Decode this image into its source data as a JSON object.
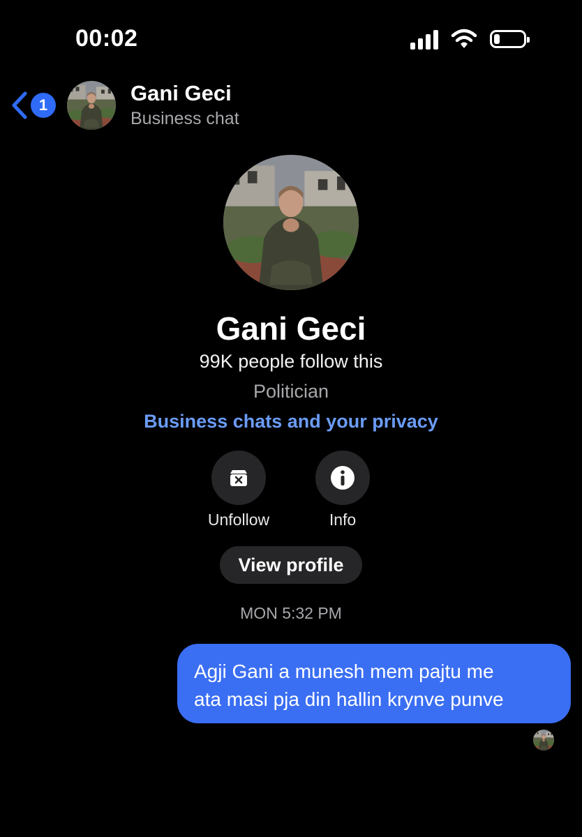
{
  "status_bar": {
    "time": "00:02",
    "signal_icon": "cellular-signal-icon",
    "wifi_icon": "wifi-icon",
    "battery_icon": "battery-icon",
    "battery_level": 0.2
  },
  "header": {
    "back_icon": "chevron-left-icon",
    "unread_count": "1",
    "name": "Gani Geci",
    "subtitle": "Business chat"
  },
  "profile": {
    "name": "Gani Geci",
    "followers": "99K people follow this",
    "category": "Politician",
    "privacy_link": "Business chats and your privacy"
  },
  "actions": [
    {
      "label": "Unfollow",
      "icon": "unfollow-icon"
    },
    {
      "label": "Info",
      "icon": "info-icon"
    }
  ],
  "view_profile_label": "View profile",
  "conversation": {
    "timestamp": "MON 5:32 PM",
    "messages": [
      {
        "sender": "me",
        "lines": [
          "Agji Gani a munesh mem pajtu me",
          "ata masi pja din hallin krynve punve"
        ]
      }
    ]
  },
  "colors": {
    "background": "#000000",
    "accent": "#2f6bf6",
    "bubble": "#3a6ef3",
    "link": "#6b9cf8",
    "secondary_text": "#a8a8ad",
    "button_bg": "#262628"
  }
}
